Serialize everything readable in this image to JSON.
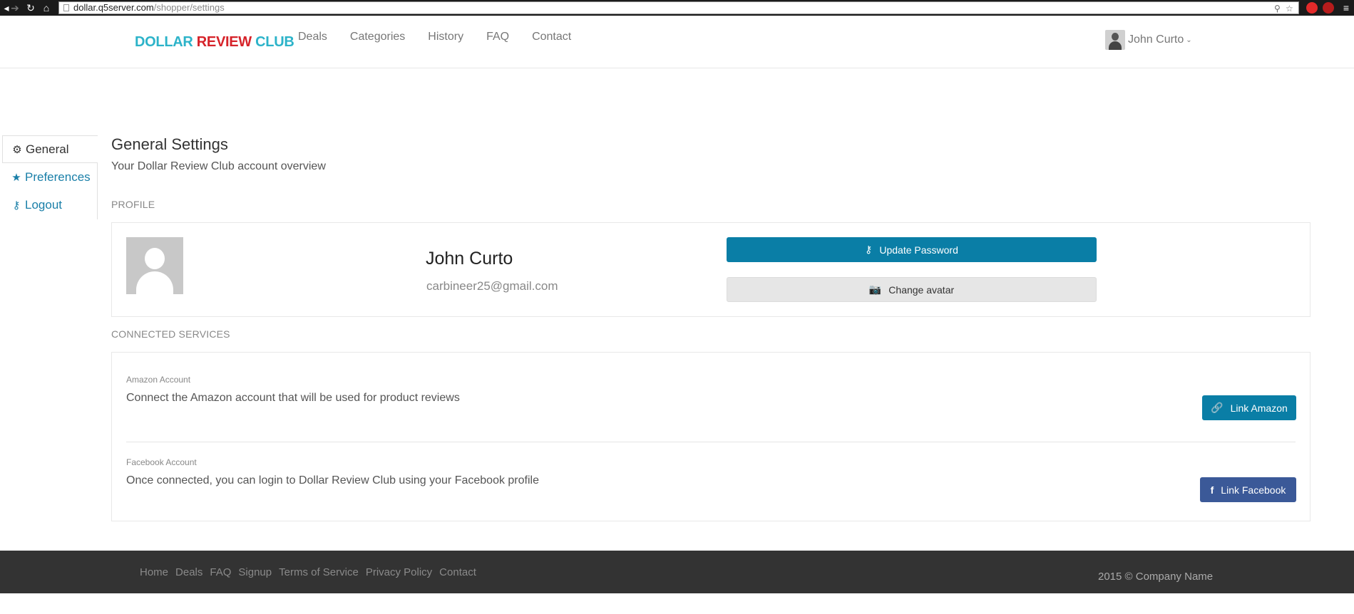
{
  "browser": {
    "url_host": "dollar.q5server.com",
    "url_path": "/shopper/settings"
  },
  "brand": {
    "part1": "DOLLAR ",
    "part2": "REVIEW ",
    "part3": "CLUB"
  },
  "nav": {
    "items": [
      {
        "label": "Deals"
      },
      {
        "label": "Categories"
      },
      {
        "label": "History"
      },
      {
        "label": "FAQ"
      },
      {
        "label": "Contact"
      }
    ]
  },
  "user": {
    "name": "John Curto"
  },
  "sidebar": {
    "items": [
      {
        "label": "General",
        "icon": "gear-icon",
        "active": true
      },
      {
        "label": "Preferences",
        "icon": "star-icon",
        "active": false
      },
      {
        "label": "Logout",
        "icon": "key-icon",
        "active": false
      }
    ]
  },
  "main": {
    "title": "General Settings",
    "subtitle": "Your Dollar Review Club account overview",
    "profile_label": "PROFILE",
    "profile": {
      "name": "John Curto",
      "email": "carbineer25@gmail.com",
      "update_password_label": "Update Password",
      "change_avatar_label": "Change avatar"
    },
    "services_label": "CONNECTED SERVICES",
    "services": [
      {
        "label": "Amazon Account",
        "description": "Connect the Amazon account that will be used for product reviews",
        "button": "Link Amazon"
      },
      {
        "label": "Facebook Account",
        "description": "Once connected, you can login to Dollar Review Club using your Facebook profile",
        "button": "Link Facebook"
      }
    ]
  },
  "footer": {
    "links": [
      {
        "label": "Home"
      },
      {
        "label": "Deals"
      },
      {
        "label": "FAQ"
      },
      {
        "label": "Signup"
      },
      {
        "label": "Terms of Service"
      },
      {
        "label": "Privacy Policy"
      },
      {
        "label": "Contact"
      }
    ],
    "copyright": "2015 © Company Name"
  },
  "colors": {
    "accent": "#0a7ea6",
    "brand_cyan": "#2cb3c9",
    "brand_red": "#d6232a",
    "facebook": "#3b5998",
    "footer_bg": "#333333"
  }
}
